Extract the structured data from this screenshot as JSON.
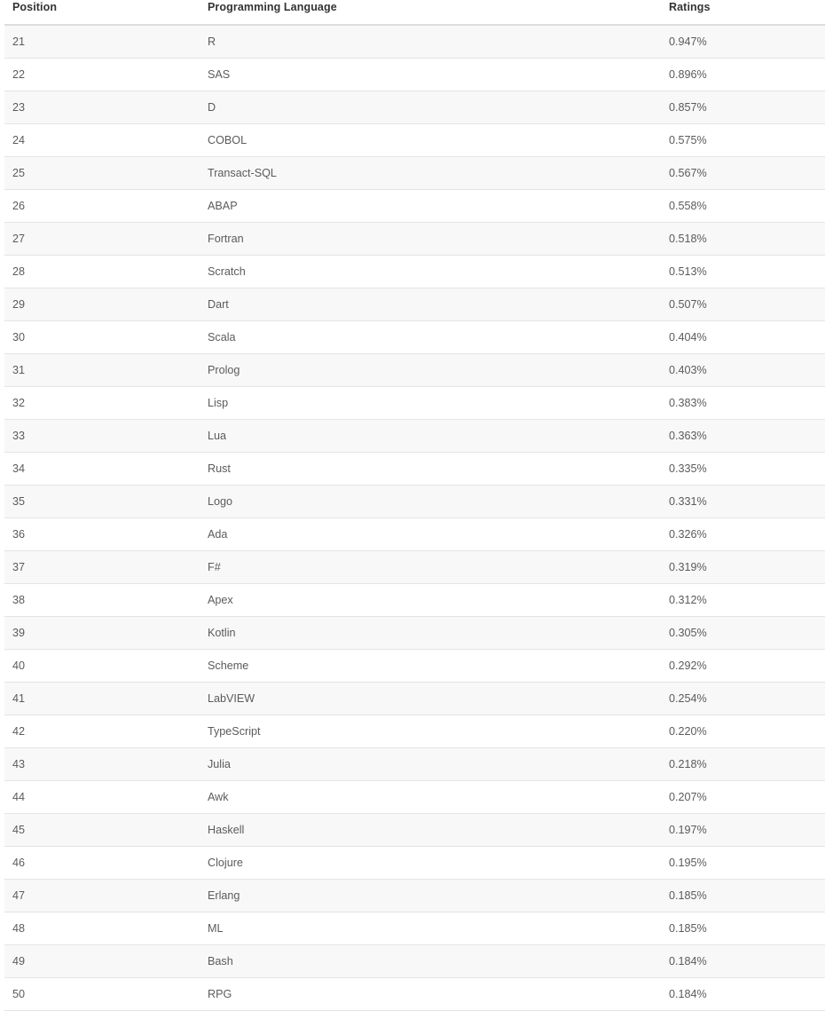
{
  "table": {
    "columns": [
      {
        "key": "position",
        "label": "Position"
      },
      {
        "key": "language",
        "label": "Programming Language"
      },
      {
        "key": "ratings",
        "label": "Ratings"
      }
    ],
    "rows": [
      {
        "position": "21",
        "language": "R",
        "ratings": "0.947%"
      },
      {
        "position": "22",
        "language": "SAS",
        "ratings": "0.896%"
      },
      {
        "position": "23",
        "language": "D",
        "ratings": "0.857%"
      },
      {
        "position": "24",
        "language": "COBOL",
        "ratings": "0.575%"
      },
      {
        "position": "25",
        "language": "Transact-SQL",
        "ratings": "0.567%"
      },
      {
        "position": "26",
        "language": "ABAP",
        "ratings": "0.558%"
      },
      {
        "position": "27",
        "language": "Fortran",
        "ratings": "0.518%"
      },
      {
        "position": "28",
        "language": "Scratch",
        "ratings": "0.513%"
      },
      {
        "position": "29",
        "language": "Dart",
        "ratings": "0.507%"
      },
      {
        "position": "30",
        "language": "Scala",
        "ratings": "0.404%"
      },
      {
        "position": "31",
        "language": "Prolog",
        "ratings": "0.403%"
      },
      {
        "position": "32",
        "language": "Lisp",
        "ratings": "0.383%"
      },
      {
        "position": "33",
        "language": "Lua",
        "ratings": "0.363%"
      },
      {
        "position": "34",
        "language": "Rust",
        "ratings": "0.335%"
      },
      {
        "position": "35",
        "language": "Logo",
        "ratings": "0.331%"
      },
      {
        "position": "36",
        "language": "Ada",
        "ratings": "0.326%"
      },
      {
        "position": "37",
        "language": "F#",
        "ratings": "0.319%"
      },
      {
        "position": "38",
        "language": "Apex",
        "ratings": "0.312%"
      },
      {
        "position": "39",
        "language": "Kotlin",
        "ratings": "0.305%"
      },
      {
        "position": "40",
        "language": "Scheme",
        "ratings": "0.292%"
      },
      {
        "position": "41",
        "language": "LabVIEW",
        "ratings": "0.254%"
      },
      {
        "position": "42",
        "language": "TypeScript",
        "ratings": "0.220%"
      },
      {
        "position": "43",
        "language": "Julia",
        "ratings": "0.218%"
      },
      {
        "position": "44",
        "language": "Awk",
        "ratings": "0.207%"
      },
      {
        "position": "45",
        "language": "Haskell",
        "ratings": "0.197%"
      },
      {
        "position": "46",
        "language": "Clojure",
        "ratings": "0.195%"
      },
      {
        "position": "47",
        "language": "Erlang",
        "ratings": "0.185%"
      },
      {
        "position": "48",
        "language": "ML",
        "ratings": "0.185%"
      },
      {
        "position": "49",
        "language": "Bash",
        "ratings": "0.184%"
      },
      {
        "position": "50",
        "language": "RPG",
        "ratings": "0.184%"
      }
    ]
  },
  "colors": {
    "header_text": "#333333",
    "body_text": "#5b5b5b",
    "row_stripe": "#f8f8f8",
    "row_plain": "#ffffff",
    "row_border": "#e4e4e4",
    "header_border": "#dddddd"
  }
}
